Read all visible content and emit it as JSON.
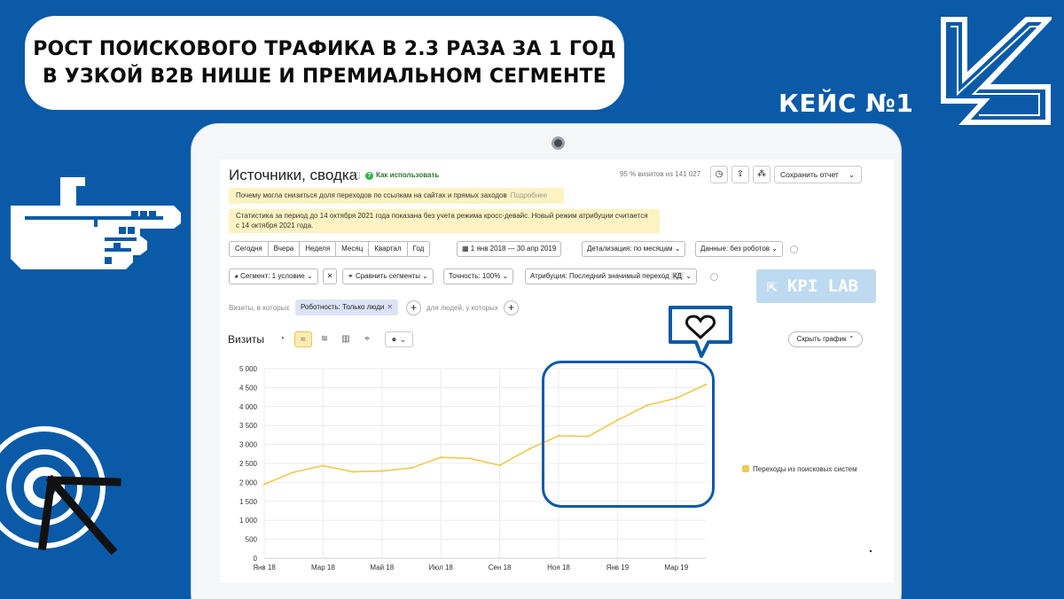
{
  "banner": {
    "line1": "РОСТ ПОИСКОВОГО ТРАФИКА В 2.3 РАЗА ЗА 1 ГОД",
    "line2": "В УЗКОЙ B2B НИШЕ И ПРЕМИАЛЬНОМ СЕГМЕНТЕ",
    "case_label": "КЕЙС №1"
  },
  "report": {
    "title": "Источники, сводка",
    "how_to": "Как использовать",
    "visits_info": "95 % визитов из 141 027",
    "save_report": "Сохранить отчет",
    "notice1": "Почему могла снизиться доля переходов по ссылкам на сайтах и прямых заходов",
    "notice1_more": "Подробнее",
    "notice2": "Статистика за период до 14 октября 2021 года показана без учета режима кросс-девайс. Новый режим атрибуции считается с 14 октября 2021 года.",
    "periods": [
      "Сегодня",
      "Вчера",
      "Неделя",
      "Месяц",
      "Квартал",
      "Год"
    ],
    "date_range": "1 янв 2018 — 30 апр 2019",
    "detail": "Детализация: по месяцам",
    "data_filter": "Данные: без роботов",
    "segment": "Сегмент: 1 условие",
    "compare": "Сравнить сегменты",
    "accuracy": "Точность: 100%",
    "attribution": "Атрибуция: Последний значимый переход",
    "attribution_tag": "КД",
    "kpi_badge": "KPI LAB",
    "visits_where": "Визиты, в которых",
    "chip": "Роботность: Только люди",
    "people_where": "для людей, у которых",
    "chart_title": "Визиты",
    "hide_chart": "Скрыть график",
    "legend": "Переходы из поисковых систем"
  },
  "chart_data": {
    "type": "line",
    "x": [
      "Янв 18",
      "Фев 18",
      "Мар 18",
      "Апр 18",
      "Май 18",
      "Июн 18",
      "Июл 18",
      "Авг 18",
      "Сен 18",
      "Окт 18",
      "Ноя 18",
      "Дек 18",
      "Янв 19",
      "Фев 19",
      "Мар 19",
      "Апр 19"
    ],
    "x_tick_labels": [
      "Янв 18",
      "Мар 18",
      "Май 18",
      "Июл 18",
      "Сен 18",
      "Ноя 18",
      "Янв 19",
      "Мар 19"
    ],
    "series": [
      {
        "name": "Переходы из поисковых систем",
        "color": "#f2c94c",
        "values": [
          1950,
          2270,
          2440,
          2280,
          2300,
          2380,
          2660,
          2630,
          2450,
          2880,
          3230,
          3210,
          3640,
          4030,
          4220,
          4580
        ]
      }
    ],
    "y_ticks": [
      0,
      500,
      1000,
      1500,
      2000,
      2500,
      3000,
      3500,
      4000,
      4500,
      5000
    ],
    "ylim": [
      0,
      5000
    ],
    "grid": true,
    "legend_position": "right"
  },
  "colors": {
    "background": "#0a5aa8",
    "highlight": "#0a5aa8",
    "line": "#f2c94c"
  }
}
